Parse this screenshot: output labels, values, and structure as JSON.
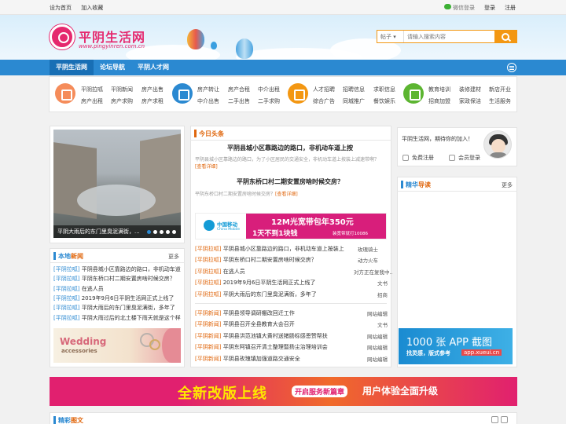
{
  "topbar": {
    "set_home": "设为首页",
    "add_fav": "加入收藏",
    "wechat_login": "微信登录",
    "login": "登录",
    "register": "注册"
  },
  "header": {
    "logo_text": "平阴生活网",
    "logo_url": "www.pingyinren.com.cn"
  },
  "search": {
    "category": "帖子",
    "placeholder": "请输入搜索内容"
  },
  "nav": {
    "items": [
      "平阴生活网",
      "论坛导航",
      "平阴人才网"
    ]
  },
  "categories": [
    {
      "color": "#f58c5a",
      "links": [
        "平阴拉呱",
        "平阴新闻",
        "房产出售",
        "房产出租",
        "房产求购",
        "房产求租"
      ]
    },
    {
      "color": "#2b89d1",
      "links": [
        "房产转让",
        "房产合租",
        "中介出租",
        "中介出售",
        "二手出售",
        "二手求购"
      ]
    },
    {
      "color": "#f39712",
      "links": [
        "人才招聘",
        "招聘信息",
        "求职信息",
        "综合广告",
        "同城推广",
        "餐饮娱乐"
      ]
    },
    {
      "color": "#5cb531",
      "links": [
        "教育培训",
        "装修建材",
        "新店开业",
        "招商加盟",
        "家政保洁",
        "生活服务"
      ]
    }
  ],
  "slideshow": {
    "caption": "平阴大雨后的东门里臭泥满街，..."
  },
  "local_news": {
    "title_a": "本地",
    "title_b": "新闻",
    "more": "更多",
    "items": [
      {
        "tag": "[平阴拉呱]",
        "text": "平阴县城小区靠路边的路口，非机动车道"
      },
      {
        "tag": "[平阴拉呱]",
        "text": "平阴东桥口村二期安置房啥时候交房？"
      },
      {
        "tag": "[平阴拉呱]",
        "text": "在逃人员"
      },
      {
        "tag": "[平阴拉呱]",
        "text": "2019年9月6日平阴生活网正式上线了"
      },
      {
        "tag": "[平阴拉呱]",
        "text": "平阴大雨后的东门里臭泥满街，多年了"
      },
      {
        "tag": "[平阴拉呱]",
        "text": "平阴大雨过后的北土楼下雨天就是这个样"
      }
    ]
  },
  "wedding_ad": {
    "title": "Wedding",
    "sub": "accessories"
  },
  "headlines": {
    "title": "今日头条",
    "items": [
      {
        "title": "平阴县城小区靠路边的路口，非机动车道上按",
        "summary": "平阴县城小区靠路边的路口，为了小区居民的交通安全，非机动车道上按装上减速带啊？",
        "more": "[查看详细]"
      },
      {
        "title": "平阴东桥口村二期安置房啥时候交房？",
        "summary": "平阴东桥口村二期安置房啥时候交房？",
        "more": "[查看详细]"
      }
    ]
  },
  "mobile_ad": {
    "brand": "中国移动",
    "brand_en": "China Mobile",
    "line1": "12M光宽带包年350元",
    "line2": "1天不到1块钱",
    "line3": "装宽带就打10086"
  },
  "center_list": {
    "group1": [
      {
        "tag": "[平阴拉呱]",
        "text": "平阴县城小区靠路边的路口，非机动车道上按装上",
        "meta": "玫瑰骑士"
      },
      {
        "tag": "[平阴拉呱]",
        "text": "平阴东桥口村二期安置房啥时候交房？",
        "meta": "动力火车"
      },
      {
        "tag": "[平阴拉呱]",
        "text": "在逃人员",
        "meta": "对方正在复我中.."
      },
      {
        "tag": "[平阴拉呱]",
        "text": "2019年9月6日平阴生活网正式上线了",
        "meta": "文书"
      },
      {
        "tag": "[平阴拉呱]",
        "text": "平阴大雨后的东门里臭泥满街，多年了",
        "meta": "招商"
      }
    ],
    "group2": [
      {
        "tag": "[平阴新闻]",
        "text": "平阴县领导调研棚改回迁工作",
        "meta": "网站编辑"
      },
      {
        "tag": "[平阴新闻]",
        "text": "平阴县召开全县教育大会召开",
        "meta": "文书"
      },
      {
        "tag": "[平阴新闻]",
        "text": "平阴县洪范池镇大黄村送猪肠标感恩赞帮扶",
        "meta": "网站编辑"
      },
      {
        "tag": "[平阴新闻]",
        "text": "平阴东阿镇召开清土整理暨扬尘治理培训会",
        "meta": "网站编辑"
      },
      {
        "tag": "[平阴新闻]",
        "text": "平阴县玫瑰镇加强道路交通安全",
        "meta": "网站编辑"
      }
    ]
  },
  "user_box": {
    "welcome": "平阴生活网，期待你的加入！",
    "free_register": "免费注册",
    "member_login": "会员登录"
  },
  "featured": {
    "title_a": "精华",
    "title_b": "导读",
    "more": "更多"
  },
  "app_ad": {
    "line1": "1000 张 APP 截图",
    "line2": "找灵感，版式参考",
    "line3": "app.xueui.cn"
  },
  "banner": {
    "text1": "全新改版上线",
    "text2": "开启服务新篇章",
    "text3": "用户体验全面升级"
  },
  "photos": {
    "title_a": "精彩",
    "title_b": "图文"
  }
}
